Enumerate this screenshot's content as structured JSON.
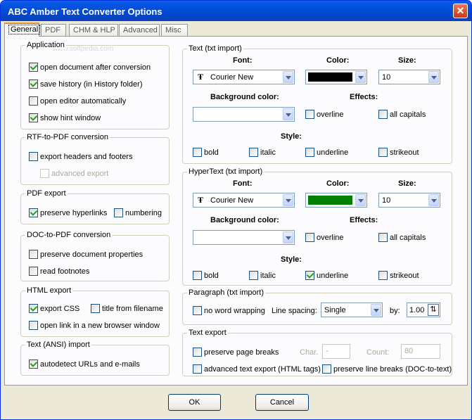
{
  "title": "ABC Amber Text Converter Options",
  "tabs": [
    "General",
    "PDF",
    "CHM & HLP",
    "Advanced",
    "Misc"
  ],
  "watermark": "www.softpedia.com",
  "left": {
    "application": {
      "title": "Application",
      "items": [
        {
          "label": "open document after conversion",
          "checked": true
        },
        {
          "label": "save history (in History folder)",
          "checked": true
        },
        {
          "label": "open editor automatically",
          "checked": false
        },
        {
          "label": "show hint window",
          "checked": true
        }
      ]
    },
    "rtf": {
      "title": "RTF-to-PDF conversion",
      "headers": "export headers and footers",
      "advanced": "advanced export"
    },
    "pdf_export": {
      "title": "PDF export",
      "hyperlinks": "preserve hyperlinks",
      "numbering": "numbering"
    },
    "doc": {
      "title": "DOC-to-PDF conversion",
      "props": "preserve document properties",
      "footnotes": "read footnotes"
    },
    "html": {
      "title": "HTML export",
      "css": "export CSS",
      "filename": "title from filename",
      "newwin": "open link in a new browser window"
    },
    "ansi": {
      "title": "Text (ANSI) import",
      "urls": "autodetect URLs and e-mails"
    }
  },
  "labels": {
    "font": "Font:",
    "color": "Color:",
    "size": "Size:",
    "bg": "Background color:",
    "effects": "Effects:",
    "style": "Style:",
    "overline": "overline",
    "caps": "all capitals",
    "bold": "bold",
    "italic": "italic",
    "underline": "underline",
    "strikeout": "strikeout"
  },
  "text_import": {
    "title": "Text (txt import)",
    "font": "Courier New",
    "color": "#000000",
    "size": "10"
  },
  "hyper_import": {
    "title": "HyperText (txt import)",
    "font": "Courier New",
    "color": "#008000",
    "size": "10"
  },
  "paragraph": {
    "title": "Paragraph (txt import)",
    "nowrap": "no word wrapping",
    "spacing_label": "Line spacing:",
    "spacing": "Single",
    "by_label": "by:",
    "by": "1.00"
  },
  "text_export": {
    "title": "Text export",
    "pagebreaks": "preserve page breaks",
    "char_label": "Char.",
    "char_value": "-",
    "count_label": "Count:",
    "count_value": "80",
    "advanced": "advanced text export (HTML tags)",
    "linebreaks": "preserve line breaks (DOC-to-text)"
  },
  "buttons": {
    "ok": "OK",
    "cancel": "Cancel"
  }
}
